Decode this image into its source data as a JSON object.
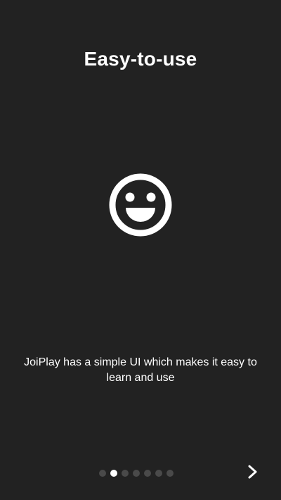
{
  "onboarding": {
    "title": "Easy-to-use",
    "icon": "smiley-face-icon",
    "description": "JoiPlay has a simple UI which makes it easy to learn and use",
    "pager": {
      "total_pages": 7,
      "active_index": 1
    },
    "next_icon": "chevron-right-icon"
  },
  "colors": {
    "background": "#222222",
    "text": "#ffffff",
    "dot_inactive": "#4a4a4a",
    "dot_active": "#ffffff"
  }
}
